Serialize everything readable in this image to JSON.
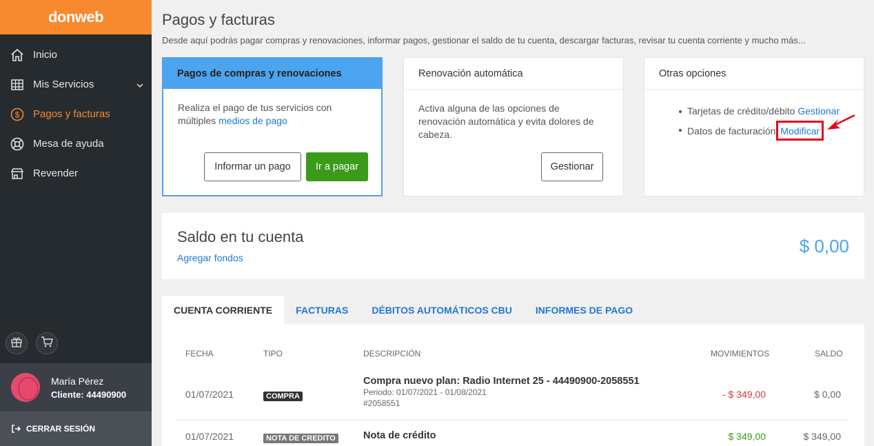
{
  "brand": {
    "logo": "donweb",
    "accent": "#f7892f",
    "link_color": "#1f78d1"
  },
  "sidebar": {
    "items": [
      {
        "label": "Inicio",
        "icon": "home-icon"
      },
      {
        "label": "Mis Servicios",
        "icon": "grid-icon"
      },
      {
        "label": "Pagos y facturas",
        "icon": "dollar-icon"
      },
      {
        "label": "Mesa de ayuda",
        "icon": "lifebuoy-icon"
      },
      {
        "label": "Revender",
        "icon": "store-icon"
      }
    ],
    "active": "Pagos y facturas",
    "user": {
      "name": "María Pérez",
      "client": "Cliente: 44490900"
    },
    "logout": "CERRAR SESIÓN"
  },
  "page": {
    "title": "Pagos y facturas",
    "description": "Desde aquí podrás pagar compras y renovaciones, informar pagos, gestionar el saldo de tu cuenta, descargar facturas, revisar tu cuenta corriente y mucho más..."
  },
  "cards": {
    "pagos": {
      "title": "Pagos de compras y renovaciones",
      "text": "Realiza el pago de tus servicios con múltiples ",
      "link": "medios de pago",
      "btn_informar": "Informar un pago",
      "btn_pagar": "Ir a pagar"
    },
    "renovacion": {
      "title": "Renovación automática",
      "text": "Activa alguna de las opciones de renovación automática y evita dolores de cabeza.",
      "btn_gestionar": "Gestionar"
    },
    "otras": {
      "title": "Otras opciones",
      "item1_text": "Tarjetas de crédito/débito ",
      "item1_link": "Gestionar",
      "item2_text": "Datos de facturación ",
      "item2_link": "Modificar"
    }
  },
  "saldo": {
    "title": "Saldo en tu cuenta",
    "link": "Agregar fondos",
    "amount": "$ 0,00"
  },
  "tabs": [
    "CUENTA CORRIENTE",
    "FACTURAS",
    "DÉBITOS AUTOMÁTICOS CBU",
    "INFORMES DE PAGO"
  ],
  "table": {
    "headers": {
      "fecha": "FECHA",
      "tipo": "TIPO",
      "descripcion": "DESCRIPCIÓN",
      "movimientos": "MOVIMIENTOS",
      "saldo": "SALDO"
    },
    "rows": [
      {
        "fecha": "01/07/2021",
        "tipo": "COMPRA",
        "descripcion": "Compra nuevo plan: Radio Internet 25 - 44490900-2058551",
        "periodo": "Periodo: 01/07/2021 - 01/08/2021",
        "ref": "#2058551",
        "movimiento": "- $ 349,00",
        "saldo": "$ 0,00"
      },
      {
        "fecha": "01/07/2021",
        "tipo": "NOTA DE CREDITO",
        "descripcion": "Nota de crédito",
        "movimiento": "$ 349,00",
        "saldo": "$ 349,00"
      }
    ]
  }
}
